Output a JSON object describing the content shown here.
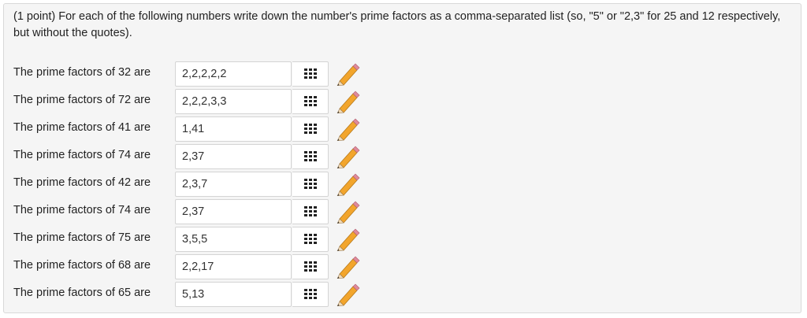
{
  "prompt": "(1 point) For each of the following numbers write down the number's prime factors as a comma-separated list (so, \"5\" or \"2,3\" for 25 and 12 respectively, but without the quotes).",
  "rows": [
    {
      "label": "The prime factors of 32 are",
      "value": "2,2,2,2,2"
    },
    {
      "label": "The prime factors of 72 are",
      "value": "2,2,2,3,3"
    },
    {
      "label": "The prime factors of 41 are",
      "value": "1,41"
    },
    {
      "label": "The prime factors of 74 are",
      "value": "2,37"
    },
    {
      "label": "The prime factors of 42 are",
      "value": "2,3,7"
    },
    {
      "label": "The prime factors of 74 are",
      "value": "2,37"
    },
    {
      "label": "The prime factors of 75 are",
      "value": "3,5,5"
    },
    {
      "label": "The prime factors of 68 are",
      "value": "2,2,17"
    },
    {
      "label": "The prime factors of 65 are",
      "value": "5,13"
    }
  ],
  "icons": {
    "palette": "grid-icon",
    "edit": "pencil-icon"
  },
  "colors": {
    "panel_bg": "#f5f5f5",
    "pencil_body": "#f2a52c",
    "pencil_tip": "#e08a9a"
  }
}
